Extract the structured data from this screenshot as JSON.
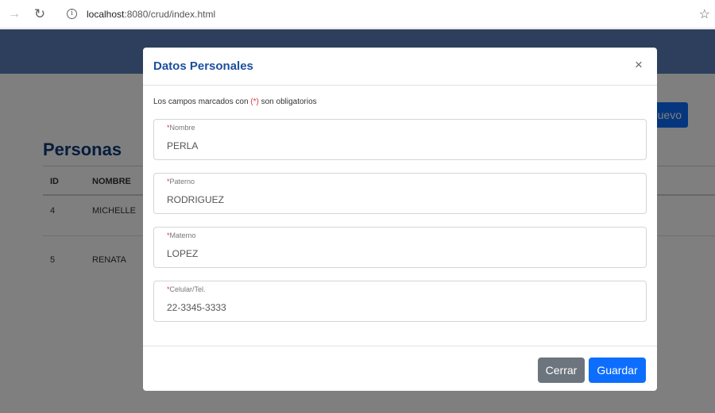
{
  "browser": {
    "url_host": "localhost",
    "url_path": ":8080/crud/index.html"
  },
  "page": {
    "title": "Personas",
    "new_button": "uevo",
    "table": {
      "headers": [
        "ID",
        "NOMBRE"
      ],
      "rows": [
        {
          "id": "4",
          "nombre": "MICHELLE"
        },
        {
          "id": "5",
          "nombre": "RENATA"
        }
      ]
    }
  },
  "modal": {
    "title": "Datos Personales",
    "close_glyph": "×",
    "required_note_prefix": "Los campos marcados con ",
    "required_note_mark": "(*)",
    "required_note_suffix": " son obligatorios",
    "fields": [
      {
        "star": "*",
        "label": "Nombre",
        "value": "PERLA"
      },
      {
        "star": "*",
        "label": "Paterno",
        "value": "RODRIGUEZ"
      },
      {
        "star": "*",
        "label": "Materno",
        "value": "LOPEZ"
      },
      {
        "star": "*",
        "label": "Celular/Tel.",
        "value": "22-3345-3333"
      }
    ],
    "buttons": {
      "close_label": "Cerrar",
      "save_label": "Guardar"
    }
  },
  "icons": {
    "forward": "forward-arrow-icon",
    "reload": "reload-icon",
    "info": "info-icon",
    "favorite": "favorite-star-icon"
  }
}
